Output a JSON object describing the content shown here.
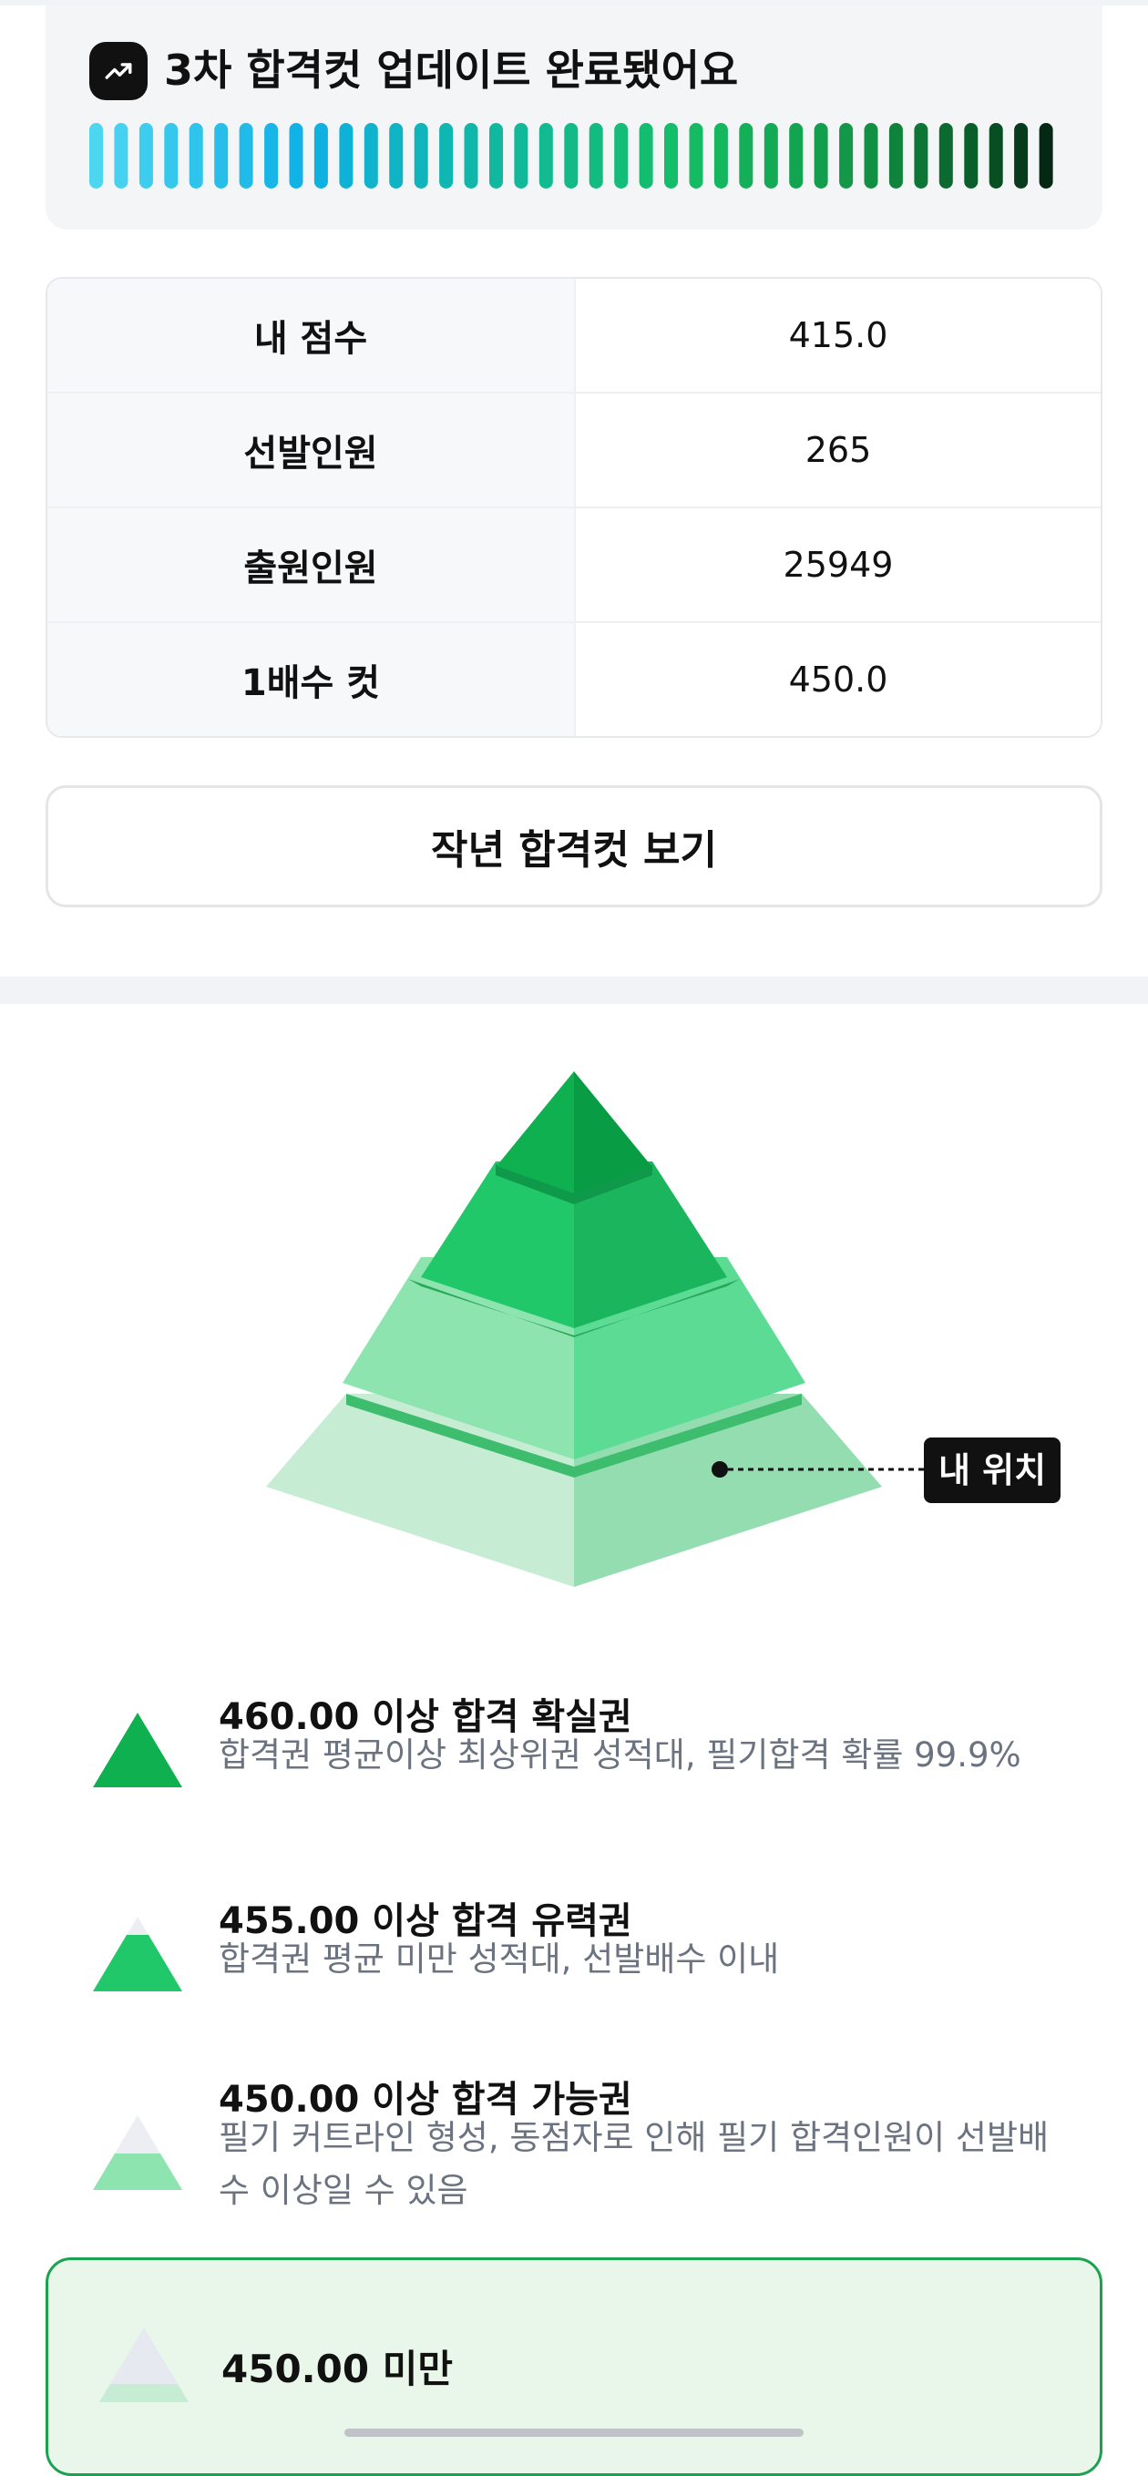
{
  "update_banner": {
    "title": "3차 합격컷 업데이트 완료됐어요",
    "icon": "trending-up-icon"
  },
  "stats_table": [
    {
      "label": "내 점수",
      "value": "415.0"
    },
    {
      "label": "선발인원",
      "value": "265"
    },
    {
      "label": "출원인원",
      "value": "25949"
    },
    {
      "label": "1배수 컷",
      "value": "450.0"
    }
  ],
  "last_year_button": "작년 합격컷 보기",
  "pyramid": {
    "my_position_label": "내 위치",
    "colors": {
      "tier1": "#0fb04f",
      "tier2": "#21c86a",
      "tier3": "#8de4ae",
      "tier4": "#c6ecd4"
    }
  },
  "legend": [
    {
      "title": "460.00 이상 합격 확실권",
      "desc": "합격권 평균이상 최상위권 성적대, 필기합격 확률 99.9%"
    },
    {
      "title": "455.00 이상 합격 유력권",
      "desc": "합격권 평균 미만 성적대, 선발배수 이내"
    },
    {
      "title": "450.00 이상 합격 가능권",
      "desc": "필기 커트라인 형성, 동점자로 인해 필기 합격인원이 선발배수 이상일 수 있음"
    }
  ],
  "current_tier": {
    "title": "450.00 미만"
  }
}
